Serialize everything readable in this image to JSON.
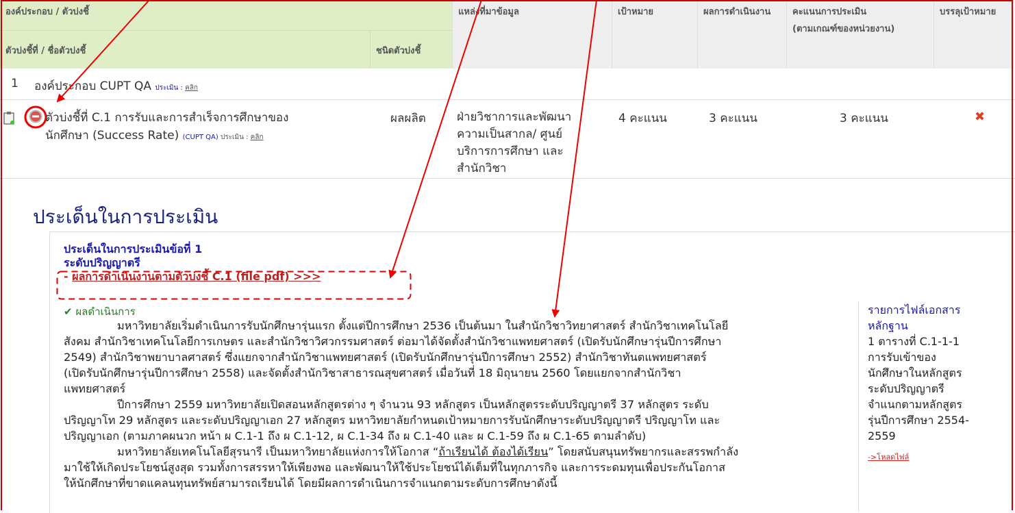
{
  "header": {
    "component": "องค์ประกอบ / ตัวบ่งชี้",
    "indicator_no": "ตัวบ่งชี้ที่ / ชื่อตัวบ่งชี้",
    "indicator_type": "ชนิดตัวบ่งชี้",
    "source": "แหล่งที่มาข้อมูล",
    "target": "เป้าหมาย",
    "result": "ผลการดำเนินงาน",
    "score_line1": "คะแนนการประเมิน",
    "score_line2": "(ตามเกณฑ์ของหน่วยงาน)",
    "achieved": "บรรลุเป้าหมาย"
  },
  "component_row": {
    "number": "1",
    "label": "องค์ประกอบ CUPT QA",
    "eval_prefix": "ประเมิน :",
    "eval_link": "คลิก"
  },
  "indicator_row": {
    "title_line1": "ตัวบ่งชี้ที่ C.1 การรับและการสำเร็จการศึกษาของ",
    "title_line2": "นักศึกษา (Success Rate)",
    "tag": "(CUPT QA)",
    "eval_prefix": "ประเมิน :",
    "eval_link": "คลิก",
    "type": "ผลผลิต",
    "source_lines": [
      "ฝ่ายวิชาการและพัฒนา",
      "ความเป็นสากล/ ศูนย์",
      "บริการการศึกษา และ",
      "สำนักวิชา"
    ],
    "target": "4 คะแนน",
    "result": "3 คะแนน",
    "score": "3 คะแนน",
    "achieved_icon": "red-x-icon"
  },
  "section_title": "ประเด็นในการประเมิน",
  "issue": {
    "heading": "ประเด็นในการประเมินข้อที่ 1",
    "level": "ระดับปริญญาตรี",
    "file_prefix": "- ",
    "file_link": "ผลการดำเนินงานตามตัวบ่งชี้ C.1 (file pdf) >>>",
    "ops_label": "ผลดำเนินการ",
    "paragraph_lines": [
      "มหาวิทยาลัยเริ่มดำเนินการรับนักศึกษารุ่นแรก ตั้งแต่ปีการศึกษา 2536 เป็นต้นมา ในสำนักวิชาวิทยาศาสตร์ สำนักวิชาเทคโนโลยี",
      "สังคม สำนักวิชาเทคโนโลยีการเกษตร และสำนักวิชาวิศวกรรมศาสตร์ ต่อมาได้จัดตั้งสำนักวิชาแพทยศาสตร์ (เปิดรับนักศึกษารุ่นปีการศึกษา",
      "2549) สำนักวิชาพยาบาลศาสตร์ ซึ่งแยกจากสำนักวิชาแพทยศาสตร์ (เปิดรับนักศึกษารุ่นปีการศึกษา 2552) สำนักวิชาทันตแพทยศาสตร์",
      "(เปิดรับนักศึกษารุ่นปีการศึกษา 2558) และจัดตั้งสำนักวิชาสาธารณสุขศาสตร์ เมื่อวันที่ 18 มิถุนายน 2560 โดยแยกจากสำนักวิชา",
      "แพทยศาสตร์",
      "ปีการศึกษา 2559  มหาวิทยาลัยเปิดสอนหลักสูตรต่าง ๆ จำนวน 93 หลักสูตร เป็นหลักสูตรระดับปริญญาตรี 37 หลักสูตร  ระดับ",
      "ปริญญาโท 29 หลักสูตร  และระดับปริญญาเอก 27 หลักสูตร  มหาวิทยาลัยกำหนดเป้าหมายการรับนักศึกษาระดับปริญญาตรี ปริญญาโท และ",
      "ปริญญาเอก (ตามภาคผนวก หน้า ผ C.1-1 ถึง ผ C.1-12, ผ C.1-34 ถึง ผ C.1-40 และ ผ C.1-59 ถึง ผ C.1-65 ตามลำดับ)",
      "มหาวิทยาลัยเทคโนโลยีสุรนารี เป็นมหาวิทยาลัยแห่งการให้โอกาส “",
      "มาใช้ให้เกิดประโยชน์สูงสุด รวมทั้งการสรรหาให้เพียงพอ และพัฒนาให้ใช้ประโยชน์ได้เต็มที่ในทุกภารกิจ และการระดมทุนเพื่อประกันโอกาส",
      "ให้นักศึกษาที่ขาดแคลนทุนทรัพย์สามารถเรียนได้  โดยมีผลการดำเนินการจำแนกตามระดับการศึกษาดังนี้"
    ],
    "slogan": "ถ้าเรียนได้ ต้องได้เรียน",
    "line9_tail": "” โดยสนับสนุนทรัพยากรและสรรพกำลัง"
  },
  "evidence": {
    "heading_line1": "รายการไฟล์เอกสาร",
    "heading_line2": "หลักฐาน",
    "item_lines": [
      "1 ตารางที่ C.1-1-1",
      "การรับเข้าของ",
      "นักศึกษาในหลักสูตร",
      "ระดับปริญญาตรี",
      "จำแนกตามหลักสูตร",
      "รุ่นปีการศึกษา 2554-",
      "2559"
    ],
    "download": "->โหลดไฟล์"
  },
  "colors": {
    "accent_red": "#cc0000",
    "link_blue": "#1a1aa6",
    "header_green": "#dfeec6"
  }
}
